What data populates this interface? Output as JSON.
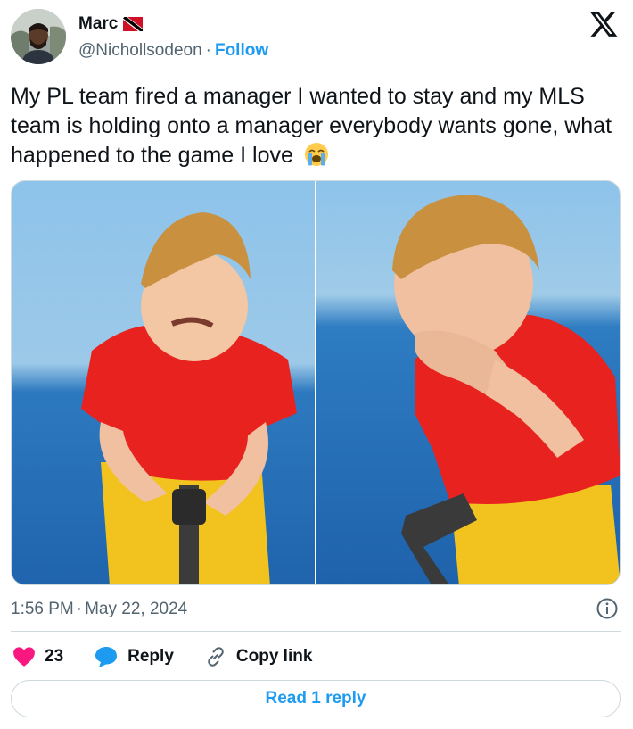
{
  "author": {
    "name": "Marc",
    "handle": "@Nichollsodeon",
    "separator": "·",
    "follow_label": "Follow"
  },
  "tweet": {
    "text": "My PL team fired a manager I wanted to stay and my MLS team is holding onto a manager everybody wants gone, what happened to the game I love",
    "emoji_icon": "loudly-crying-face-icon"
  },
  "media": {
    "photos": [
      {
        "name": "crying-boy-photo-left"
      },
      {
        "name": "crying-boy-photo-right"
      }
    ]
  },
  "meta": {
    "time": "1:56 PM",
    "separator": "·",
    "date": "May 22, 2024"
  },
  "actions": {
    "like_count": "23",
    "reply_label": "Reply",
    "copy_link_label": "Copy link"
  },
  "read_reply_label": "Read 1 reply",
  "colors": {
    "accent": "#1d9bf0",
    "like": "#f91880",
    "text": "#0f1419",
    "muted": "#536471",
    "border": "#cfd9de"
  }
}
